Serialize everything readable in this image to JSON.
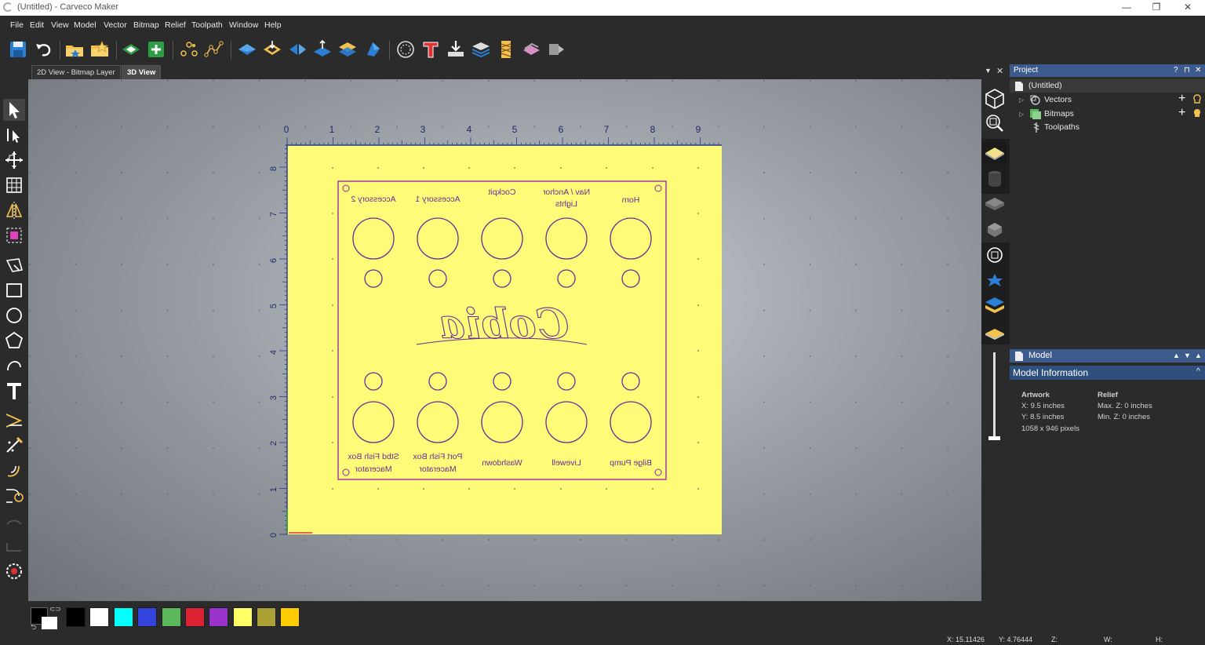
{
  "window": {
    "title": "(Untitled) - Carveco Maker",
    "minimize": "—",
    "maximize": "❐",
    "close": "✕"
  },
  "menu": [
    "File",
    "Edit",
    "View",
    "Model",
    "Vector",
    "Bitmap",
    "Relief",
    "Toolpath",
    "Window",
    "Help"
  ],
  "tabs": [
    "2D View - Bitmap Layer",
    "3D View"
  ],
  "active_tab": "3D View",
  "viewport": {
    "ruler_x": [
      "0",
      "1",
      "2",
      "3",
      "4",
      "5",
      "6",
      "7",
      "8",
      "9"
    ],
    "ruler_y": [
      "0",
      "1",
      "2",
      "3",
      "4",
      "5",
      "6",
      "7",
      "8"
    ],
    "top_labels": [
      "Horn",
      "Nav / Anchor",
      "Lights",
      "Cockpit",
      "Accessory 1",
      "Accessory 2"
    ],
    "bottom_labels": [
      "Bilge Pump",
      "Livewell",
      "Washdown",
      "Port Fish Box",
      "Macerator",
      "Stbd Fish Box",
      "Macerator"
    ],
    "logo_text": "Cobia"
  },
  "project": {
    "header": "Project",
    "help": "?",
    "pin": "⊓",
    "close": "✕",
    "root": "(Untitled)",
    "items": [
      "Vectors",
      "Bitmaps",
      "Toolpaths"
    ]
  },
  "model": {
    "header": "Model",
    "section": "Model Information",
    "artwork_title": "Artwork",
    "artwork_x": "X: 9.5 inches",
    "artwork_y": "Y: 8.5 inches",
    "artwork_px": "1058 x 946 pixels",
    "relief_title": "Relief",
    "relief_max": "Max. Z: 0 inches",
    "relief_min": "Min. Z: 0 inches"
  },
  "palette": [
    "#000000",
    "#ffffff",
    "#00ffff",
    "#3344dd",
    "#5cb85c",
    "#dd2233",
    "#9933cc",
    "#ffff66",
    "#aaa033",
    "#ffcc00"
  ],
  "status": {
    "x": "X: 15.11426",
    "y": "Y: 4.76444",
    "z": "Z:",
    "w": "W:",
    "h": "H:"
  }
}
